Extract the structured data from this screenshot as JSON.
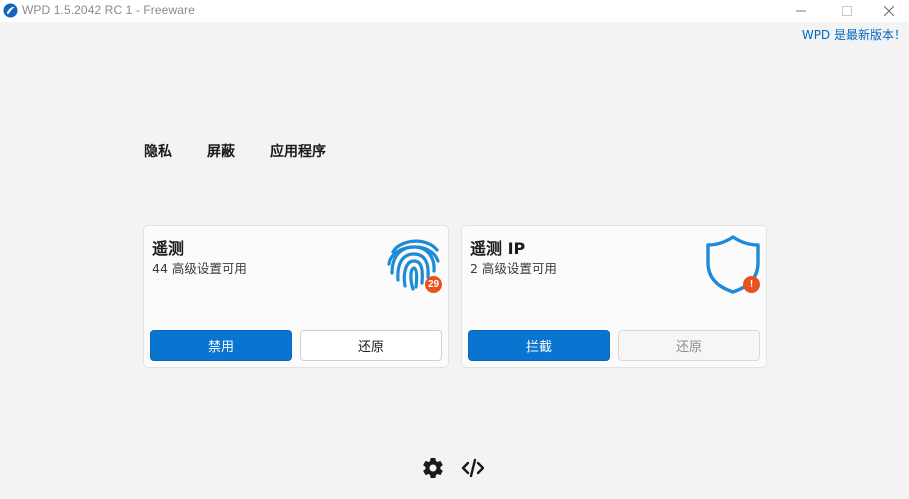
{
  "window": {
    "title": "WPD 1.5.2042 RC 1 - Freeware",
    "icon": "wpd-logo-icon"
  },
  "status": {
    "update_text": "WPD 是最新版本！"
  },
  "tabs": [
    {
      "label": "隐私"
    },
    {
      "label": "屏蔽"
    },
    {
      "label": "应用程序"
    }
  ],
  "cards": [
    {
      "title": "遥测",
      "subtitle": "44 高级设置可用",
      "icon": "fingerprint-icon",
      "badge": "29",
      "primary_label": "禁用",
      "secondary_label": "还原",
      "secondary_enabled": true
    },
    {
      "title": "遥测 IP",
      "subtitle": "2 高级设置可用",
      "icon": "shield-alert-icon",
      "badge": "!",
      "primary_label": "拦截",
      "secondary_label": "还原",
      "secondary_enabled": false
    }
  ],
  "footer": {
    "icons": [
      "gear-icon",
      "code-icon"
    ]
  },
  "colors": {
    "accent": "#0a74d1",
    "badge": "#e8521e",
    "link": "#0067c0",
    "background": "#f3f3f3"
  }
}
